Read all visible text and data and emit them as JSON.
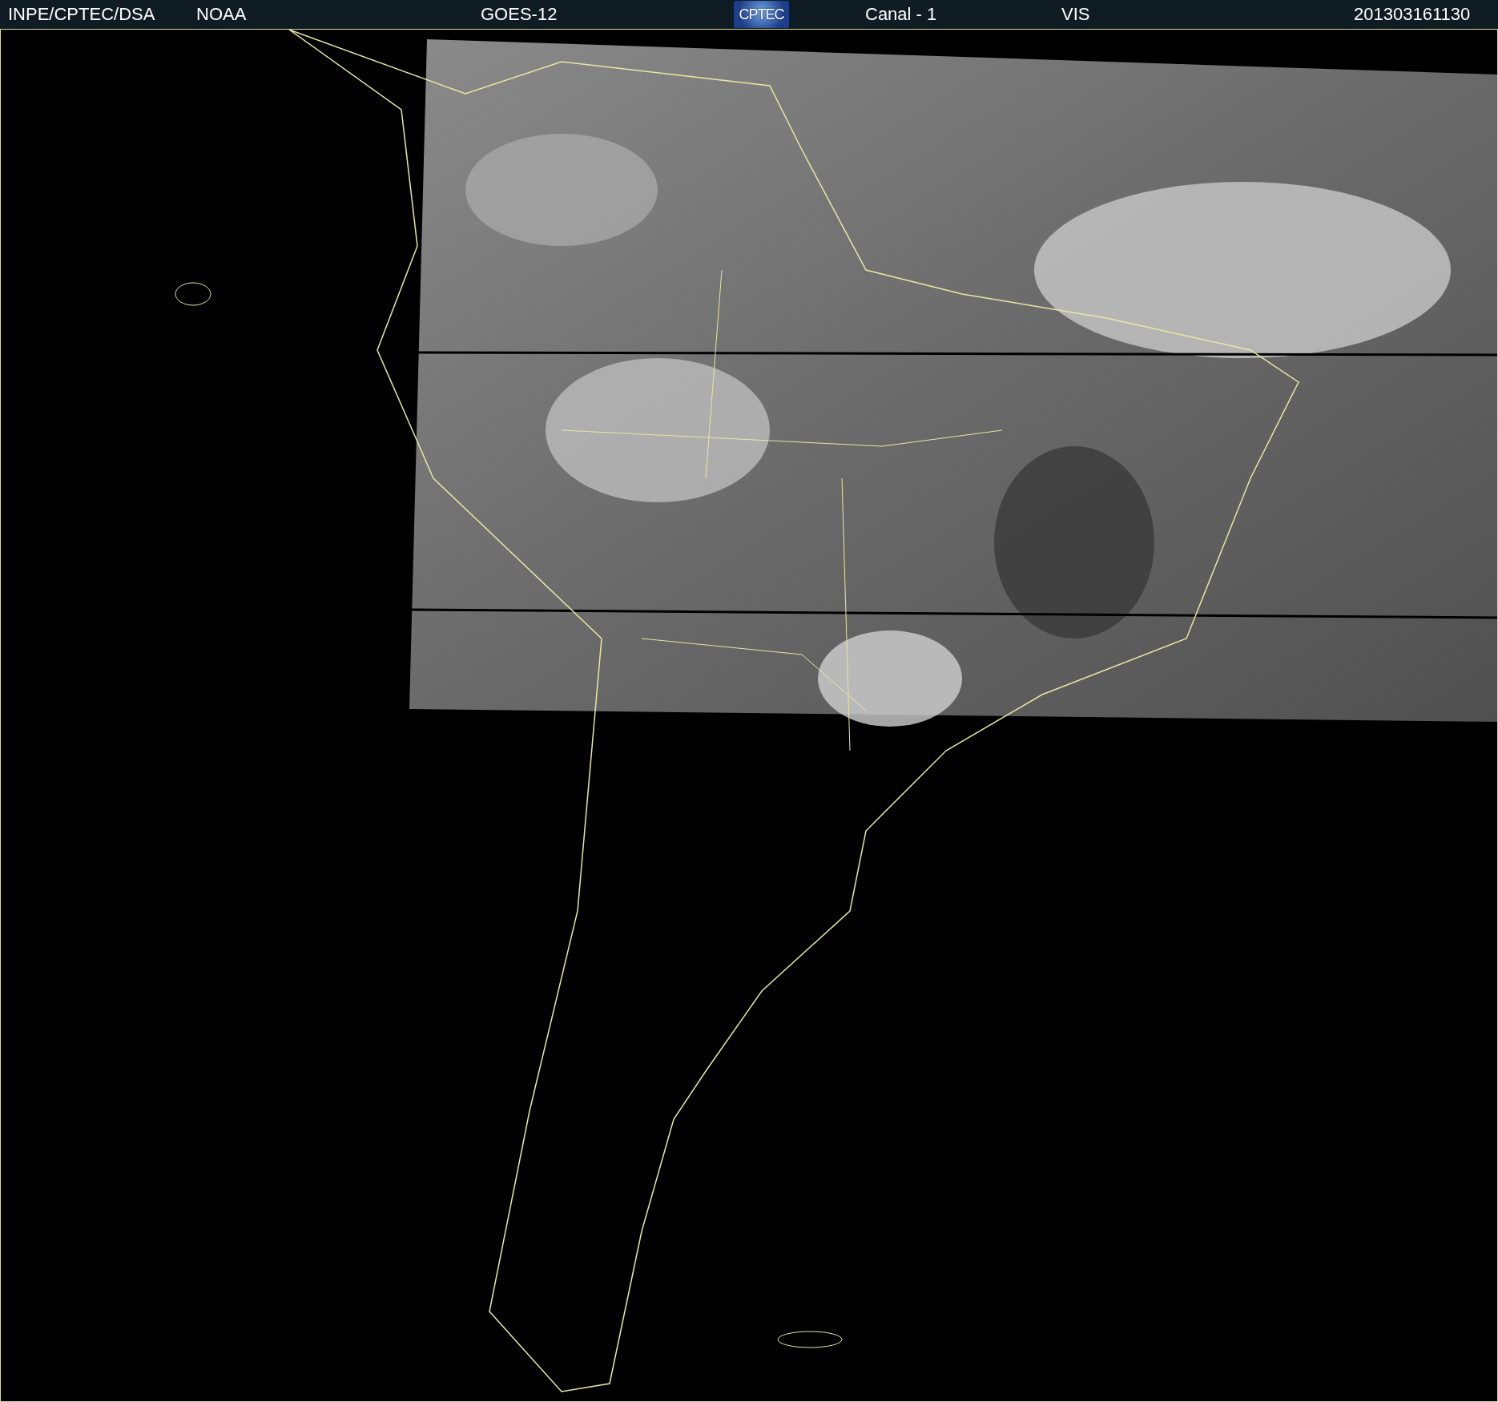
{
  "header": {
    "items": [
      {
        "kind": "text",
        "text": "INPE/CPTEC/DSA"
      },
      {
        "kind": "text",
        "text": "NOAA"
      },
      {
        "kind": "text",
        "text": "GOES-12"
      },
      {
        "kind": "logo",
        "text": "CPTEC"
      },
      {
        "kind": "text",
        "text": "Canal - 1"
      },
      {
        "kind": "text",
        "text": "VIS"
      },
      {
        "kind": "text",
        "text": "201303161130"
      }
    ]
  }
}
